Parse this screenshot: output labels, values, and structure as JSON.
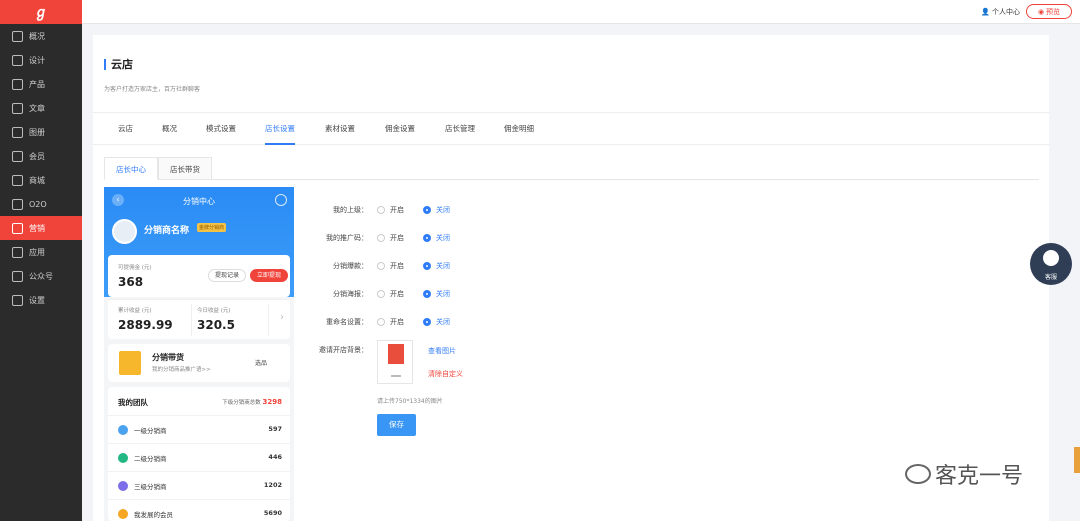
{
  "sidebar": {
    "logo": "ℊ",
    "items": [
      {
        "label": "概况",
        "icon": "chart-icon"
      },
      {
        "label": "设计",
        "icon": "compass-icon"
      },
      {
        "label": "产品",
        "icon": "box-icon"
      },
      {
        "label": "文章",
        "icon": "document-icon"
      },
      {
        "label": "图册",
        "icon": "image-icon"
      },
      {
        "label": "会员",
        "icon": "user-icon"
      },
      {
        "label": "商城",
        "icon": "clipboard-icon"
      },
      {
        "label": "O2O",
        "icon": "store-icon"
      },
      {
        "label": "营销",
        "icon": "trend-icon",
        "active": true
      },
      {
        "label": "应用",
        "icon": "grid-icon"
      },
      {
        "label": "公众号",
        "icon": "card-icon"
      },
      {
        "label": "设置",
        "icon": "gear-icon"
      }
    ]
  },
  "topbar": {
    "user_center": "个人中心",
    "preview": "预览"
  },
  "page": {
    "title": "云店",
    "desc": "为客户打造万家店主，百万社群聊客"
  },
  "tabs": [
    "云店",
    "概况",
    "模式设置",
    "店长设置",
    "素材设置",
    "佣金设置",
    "店长管理",
    "佣金明细"
  ],
  "active_tab": 3,
  "subtabs": [
    "店长中心",
    "店长带货"
  ],
  "phone": {
    "back": "‹",
    "title": "分销中心",
    "name": "分销商名称",
    "badge": "金牌分销商",
    "withdrawable_label": "可提佣金 (元)",
    "withdrawable_value": "368",
    "record_btn": "提现记录",
    "withdraw_btn": "立即提现",
    "total_label": "累计收益 (元)",
    "total_value": "2889.99",
    "today_label": "今日收益 (元)",
    "today_value": "320.5",
    "goods_title": "分销带货",
    "goods_sub": "我的分销商品推广语>>",
    "goods_btn": "选品",
    "team_title": "我的团队",
    "team_total_label": "下级分销商总数",
    "team_total": "3298",
    "team_rows": [
      {
        "label": "一级分销商",
        "value": "597",
        "color": "#4ba3f0"
      },
      {
        "label": "二级分销商",
        "value": "446",
        "color": "#23b883"
      },
      {
        "label": "三级分销商",
        "value": "1202",
        "color": "#7b6ee8"
      },
      {
        "label": "我发展的会员",
        "value": "5690",
        "color": "#f5a623"
      }
    ]
  },
  "form": {
    "on": "开启",
    "off": "关闭",
    "rows": [
      "我的上级：",
      "我的推广码：",
      "分销爆款：",
      "分销海报：",
      "重命名设置："
    ],
    "bg_label": "邀请开店背景：",
    "view_image": "查看图片",
    "clear_custom": "清除自定义",
    "upload_tip": "请上传750*1334的图片",
    "save": "保存"
  },
  "kefu": "客服",
  "watermark": "客克一号"
}
